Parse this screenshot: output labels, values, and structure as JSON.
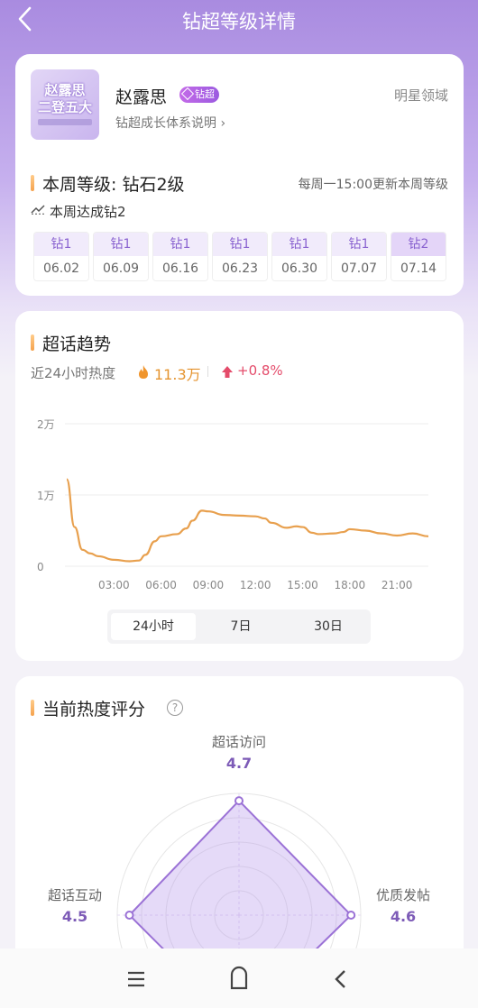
{
  "header": {
    "title": "钻超等级详情"
  },
  "profile": {
    "thumb_line1": "赵露思",
    "thumb_line2": "二登五大",
    "name": "赵露思",
    "badge": "钻超",
    "growth_link": "钻超成长体系说明 ›",
    "domain": "明星领域"
  },
  "level": {
    "title": "本周等级: 钻石2级",
    "update_note": "每周一15:00更新本周等级",
    "week_status": "本周达成钻2",
    "weeks": [
      {
        "level": "钻1",
        "date": "06.02"
      },
      {
        "level": "钻1",
        "date": "06.09"
      },
      {
        "level": "钻1",
        "date": "06.16"
      },
      {
        "level": "钻1",
        "date": "06.23"
      },
      {
        "level": "钻1",
        "date": "06.30"
      },
      {
        "level": "钻1",
        "date": "07.07"
      },
      {
        "level": "钻2",
        "date": "07.14"
      }
    ]
  },
  "trend": {
    "title": "超话趋势",
    "heat_label": "近24小时热度",
    "heat_value": "11.3万",
    "change": "+0.8%",
    "tabs": [
      "24小时",
      "7日",
      "30日"
    ],
    "active_tab": "24小时"
  },
  "chart_data": {
    "type": "line",
    "x_ticks": [
      "03:00",
      "06:00",
      "09:00",
      "12:00",
      "15:00",
      "18:00",
      "21:00"
    ],
    "y_ticks": [
      "0",
      "1万",
      "2万"
    ],
    "ylim": [
      0,
      20000
    ],
    "x_range_hours": [
      0,
      23
    ],
    "line_color": "#e8a04e",
    "series": [
      {
        "x": [
          0,
          0.5,
          1,
          1.5,
          2,
          3,
          4,
          4.6,
          5,
          5.6,
          6,
          7,
          7.6,
          8,
          8.6,
          9,
          10,
          11,
          12,
          12.6,
          13,
          14,
          14.6,
          15,
          15.6,
          16,
          17,
          17.6,
          18,
          19,
          20,
          21,
          22,
          23
        ],
        "values": [
          12200,
          5500,
          2300,
          1800,
          1400,
          900,
          700,
          800,
          1600,
          3500,
          4200,
          4500,
          5300,
          6400,
          7800,
          7700,
          7200,
          7100,
          7000,
          6700,
          6100,
          5400,
          5600,
          5500,
          4700,
          4500,
          4600,
          4800,
          5200,
          5000,
          4600,
          4300,
          4600,
          4200
        ]
      }
    ]
  },
  "score": {
    "title": "当前热度评分",
    "help": "?",
    "axes": [
      {
        "label": "超话访问",
        "score": "4.7"
      },
      {
        "label": "优质发帖",
        "score": "4.6"
      },
      {
        "label": "超话互动",
        "score": "4.5"
      }
    ],
    "max_score": 5
  },
  "nav": {
    "menu_icon": "menu-icon",
    "home_icon": "home-icon",
    "back_icon": "back-icon"
  }
}
